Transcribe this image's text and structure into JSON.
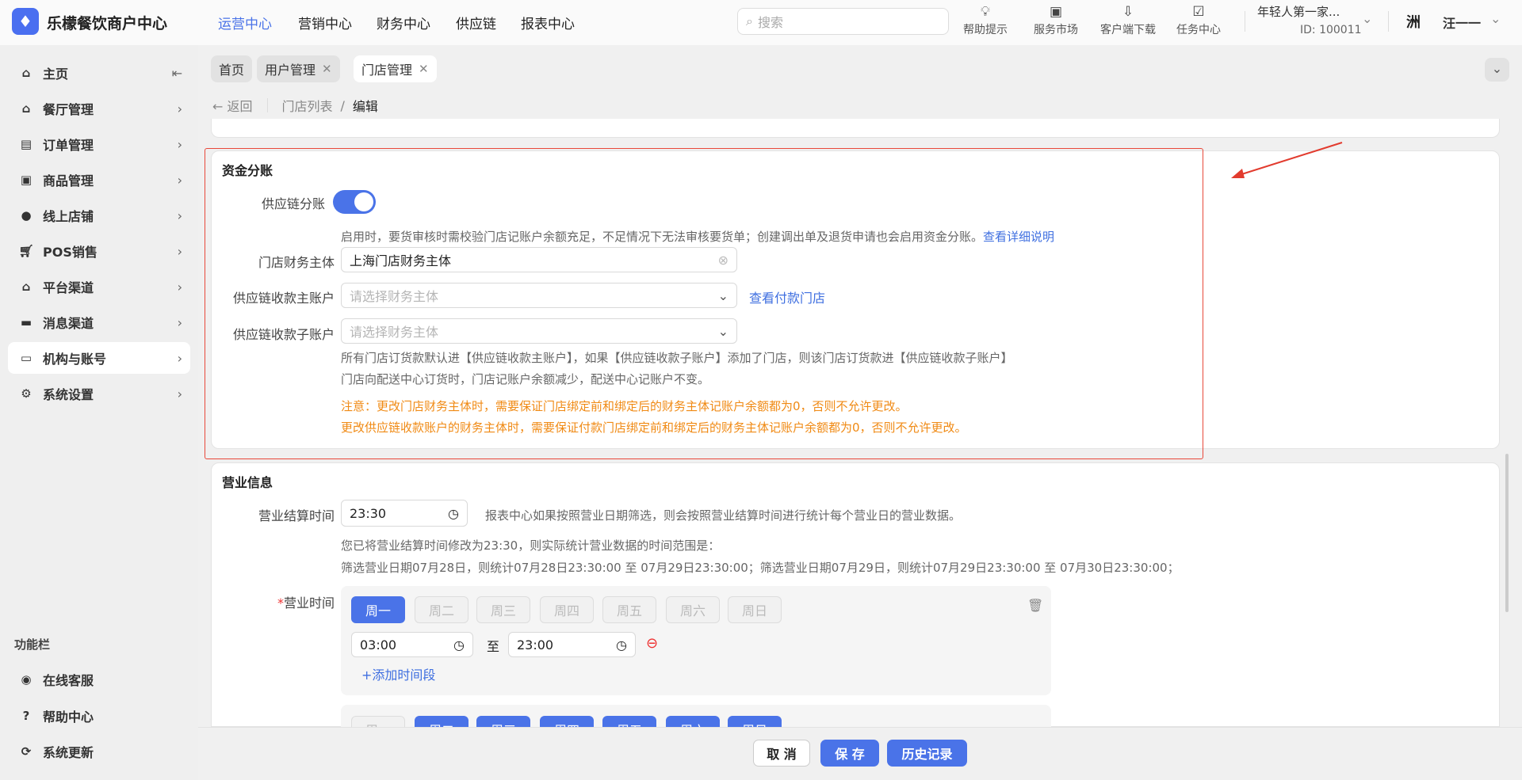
{
  "header": {
    "app_title": "乐檬餐饮商户中心",
    "nav": [
      "运营中心",
      "营销中心",
      "财务中心",
      "供应链",
      "报表中心"
    ],
    "search_placeholder": "搜索",
    "tools": [
      "帮助提示",
      "服务市场",
      "客户端下载",
      "任务中心"
    ],
    "store_name": "年轻人第一家...",
    "store_id": "ID: 100011",
    "avatar_text": "洲",
    "user_name": "汪一一"
  },
  "sidebar": {
    "items": [
      "主页",
      "餐厅管理",
      "订单管理",
      "商品管理",
      "线上店铺",
      "POS销售",
      "平台渠道",
      "消息渠道",
      "机构与账号",
      "系统设置"
    ],
    "section": "功能栏",
    "bottom": [
      "在线客服",
      "帮助中心",
      "系统更新"
    ]
  },
  "tabs": [
    "首页",
    "用户管理",
    "门店管理"
  ],
  "breadcrumb": {
    "back": "返回",
    "list": "门店列表",
    "sep": "/",
    "current": "编辑"
  },
  "fund": {
    "title": "资金分账",
    "toggle_label": "供应链分账",
    "toggle_on": true,
    "toggle_hint": "启用时，要货审核时需校验门店记账户余额充足，不足情况下无法审核要货单；创建调出单及退货申请也会启用资金分账。",
    "detail_link": "查看详细说明",
    "entity_label": "门店财务主体",
    "entity_value": "上海门店财务主体",
    "main_label": "供应链收款主账户",
    "main_placeholder": "请选择财务主体",
    "pay_store_link": "查看付款门店",
    "sub_label": "供应链收款子账户",
    "sub_placeholder": "请选择财务主体",
    "note1": "所有门店订货款默认进【供应链收款主账户】，如果【供应链收款子账户】添加了门店，则该门店订货款进【供应链收款子账户】",
    "note2": "门店向配送中心订货时，门店记账户余额减少，配送中心记账户不变。",
    "warn1": "注意：更改门店财务主体时，需要保证门店绑定前和绑定后的财务主体记账户余额都为0，否则不允许更改。",
    "warn2": "更改供应链收款账户的财务主体时，需要保证付款门店绑定前和绑定后的财务主体记账户余额都为0，否则不允许更改。"
  },
  "business": {
    "title": "营业信息",
    "settle_label": "营业结算时间",
    "settle_value": "23:30",
    "settle_hint": "报表中心如果按照营业日期筛选，则会按照营业结算时间进行统计每个营业日的营业数据。",
    "range_line1": "您已将营业结算时间修改为23:30，则实际统计营业数据的时间范围是：",
    "range_line2": "筛选营业日期07月28日，则统计07月28日23:30:00 至 07月29日23:30:00；筛选营业日期07月29日，则统计07月29日23:30:00 至 07月30日23:30:00；",
    "hours_required": "*",
    "hours_label": "营业时间",
    "days": [
      "周一",
      "周二",
      "周三",
      "周四",
      "周五",
      "周六",
      "周日"
    ],
    "block1_selected": [
      true,
      false,
      false,
      false,
      false,
      false,
      false
    ],
    "block2_selected": [
      false,
      true,
      true,
      true,
      true,
      true,
      true
    ],
    "start": "03:00",
    "to": "至",
    "end": "23:00",
    "add_period": "+添加时间段"
  },
  "footer": {
    "cancel": "取 消",
    "save": "保 存",
    "history": "历史记录"
  }
}
